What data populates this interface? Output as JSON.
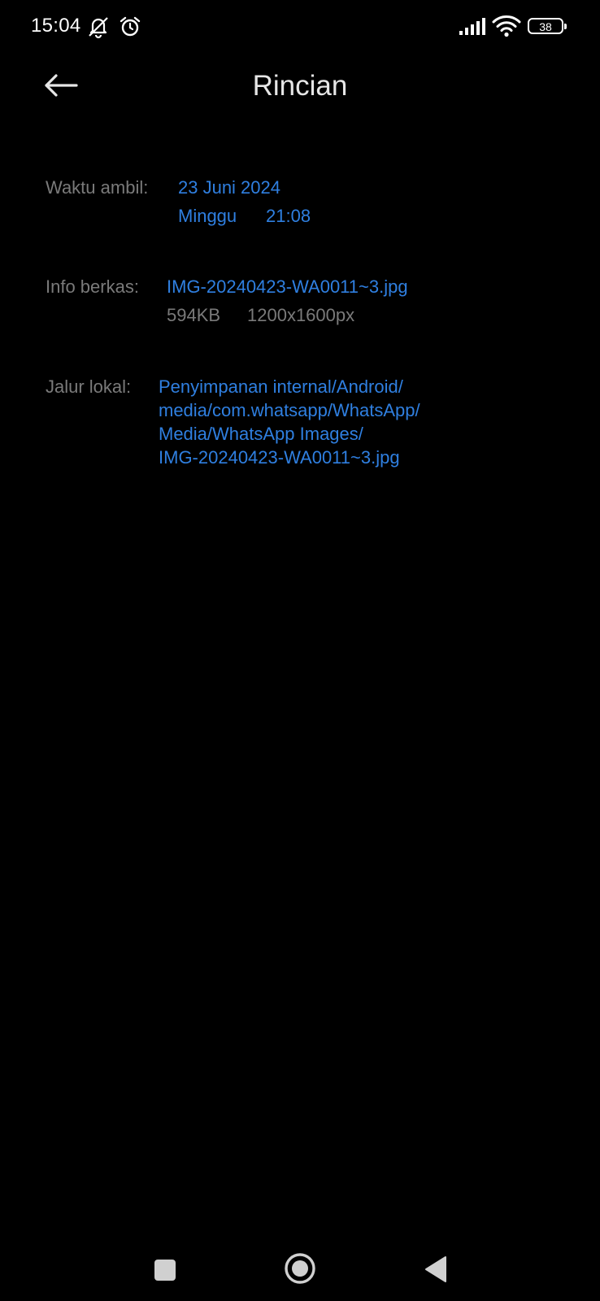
{
  "status_bar": {
    "time": "15:04",
    "battery": "38",
    "icons": [
      "bell-off-icon",
      "alarm-icon",
      "signal-icon",
      "wifi-icon",
      "battery-icon"
    ]
  },
  "header": {
    "title": "Rincian",
    "back_icon": "arrow-left-icon"
  },
  "details": {
    "taken": {
      "label": "Waktu ambil:",
      "date": "23 Juni 2024",
      "day": "Minggu",
      "time": "21:08"
    },
    "file_info": {
      "label": "Info berkas:",
      "filename": "IMG-20240423-WA0011~3.jpg",
      "size": "594KB",
      "resolution": "1200x1600px"
    },
    "local_path": {
      "label": "Jalur lokal:",
      "lines": [
        "Penyimpanan internal/Android/",
        "media/com.whatsapp/WhatsApp/",
        "Media/WhatsApp Images/",
        "IMG-20240423-WA0011~3.jpg"
      ]
    }
  },
  "nav_bar": {
    "icons": [
      "recents-square-icon",
      "home-circle-icon",
      "back-triangle-icon"
    ]
  },
  "colors": {
    "background": "#000000",
    "label": "#7a7a7a",
    "link": "#2f7fe0",
    "title": "#e6e6e6"
  }
}
